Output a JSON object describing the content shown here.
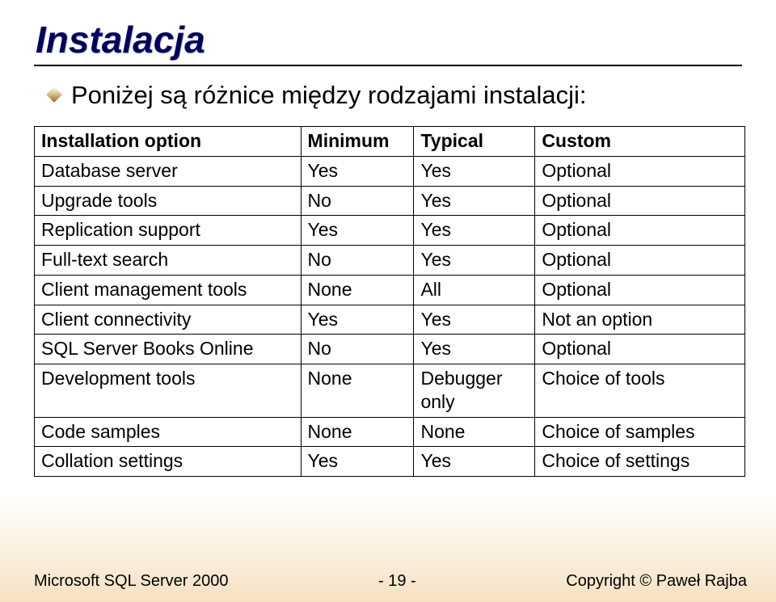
{
  "title": "Instalacja",
  "intro": "Poniżej są różnice między rodzajami instalacji:",
  "table": {
    "headers": [
      "Installation option",
      "Minimum",
      "Typical",
      "Custom"
    ],
    "rows": [
      [
        "Database server",
        "Yes",
        "Yes",
        "Optional"
      ],
      [
        "Upgrade tools",
        "No",
        "Yes",
        "Optional"
      ],
      [
        "Replication support",
        "Yes",
        "Yes",
        "Optional"
      ],
      [
        "Full-text search",
        "No",
        "Yes",
        "Optional"
      ],
      [
        "Client management tools",
        "None",
        "All",
        "Optional"
      ],
      [
        "Client connectivity",
        "Yes",
        "Yes",
        "Not an option"
      ],
      [
        "SQL Server Books Online",
        "No",
        "Yes",
        "Optional"
      ],
      [
        "Development tools",
        "None",
        "Debugger only",
        "Choice of tools"
      ],
      [
        "Code samples",
        "None",
        "None",
        "Choice of samples"
      ],
      [
        "Collation settings",
        "Yes",
        "Yes",
        "Choice of settings"
      ]
    ]
  },
  "footer": {
    "left": "Microsoft SQL Server 2000",
    "center": "- 19 -",
    "right": "Copyright © Paweł Rajba"
  }
}
